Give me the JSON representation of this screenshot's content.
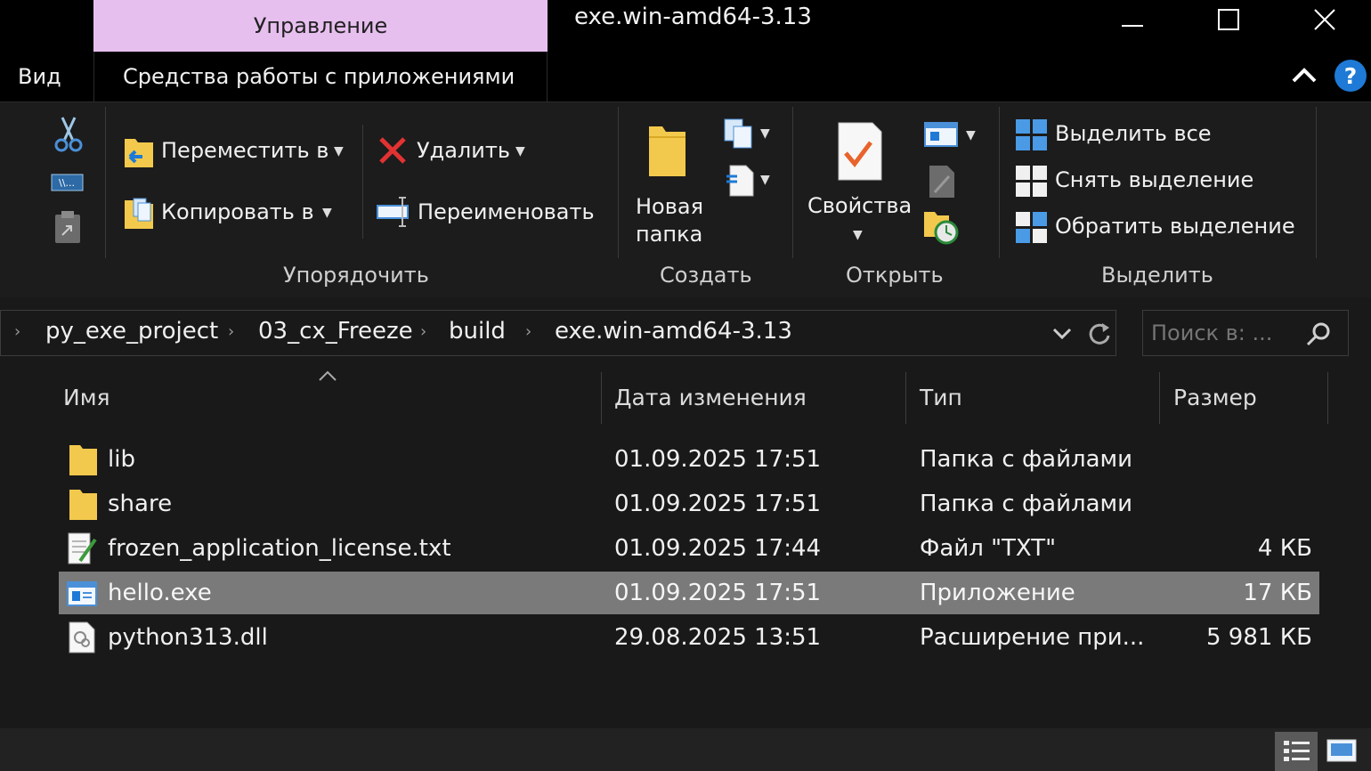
{
  "window": {
    "context_tab": "Управление",
    "title": "exe.win-amd64-3.13"
  },
  "tabs": {
    "view": "Вид",
    "app_tools": "Средства работы с приложениями"
  },
  "ribbon": {
    "organize": {
      "move_to": "Переместить в",
      "copy_to": "Копировать в",
      "delete": "Удалить",
      "rename": "Переименовать",
      "label": "Упорядочить"
    },
    "create": {
      "new_folder_line1": "Новая",
      "new_folder_line2": "папка",
      "label": "Создать"
    },
    "open": {
      "properties": "Свойства",
      "label": "Открыть"
    },
    "select": {
      "select_all": "Выделить все",
      "select_none": "Снять выделение",
      "invert": "Обратить выделение",
      "label": "Выделить"
    }
  },
  "address": {
    "crumbs": [
      "py_exe_project",
      "03_cx_Freeze",
      "build",
      "exe.win-amd64-3.13"
    ],
    "search_placeholder": "Поиск в: ..."
  },
  "columns": {
    "name": "Имя",
    "date": "Дата изменения",
    "type": "Тип",
    "size": "Размер"
  },
  "files": [
    {
      "name": "lib",
      "date": "01.09.2025 17:51",
      "type": "Папка с файлами",
      "size": "",
      "icon": "folder-icon"
    },
    {
      "name": "share",
      "date": "01.09.2025 17:51",
      "type": "Папка с файлами",
      "size": "",
      "icon": "folder-icon"
    },
    {
      "name": "frozen_application_license.txt",
      "date": "01.09.2025 17:44",
      "type": "Файл \"TXT\"",
      "size": "4 КБ",
      "icon": "text-file-icon"
    },
    {
      "name": "hello.exe",
      "date": "01.09.2025 17:51",
      "type": "Приложение",
      "size": "17 КБ",
      "icon": "exe-icon",
      "selected": true
    },
    {
      "name": "python313.dll",
      "date": "29.08.2025 13:51",
      "type": "Расширение при...",
      "size": "5 981 КБ",
      "icon": "dll-icon"
    }
  ],
  "colors": {
    "context_tab": "#e7bfef",
    "ribbon_bg": "#1c1c1c",
    "selected_row": "#7a7a7a",
    "folder": "#f2c94c",
    "accent_blue": "#1e7ad6"
  }
}
